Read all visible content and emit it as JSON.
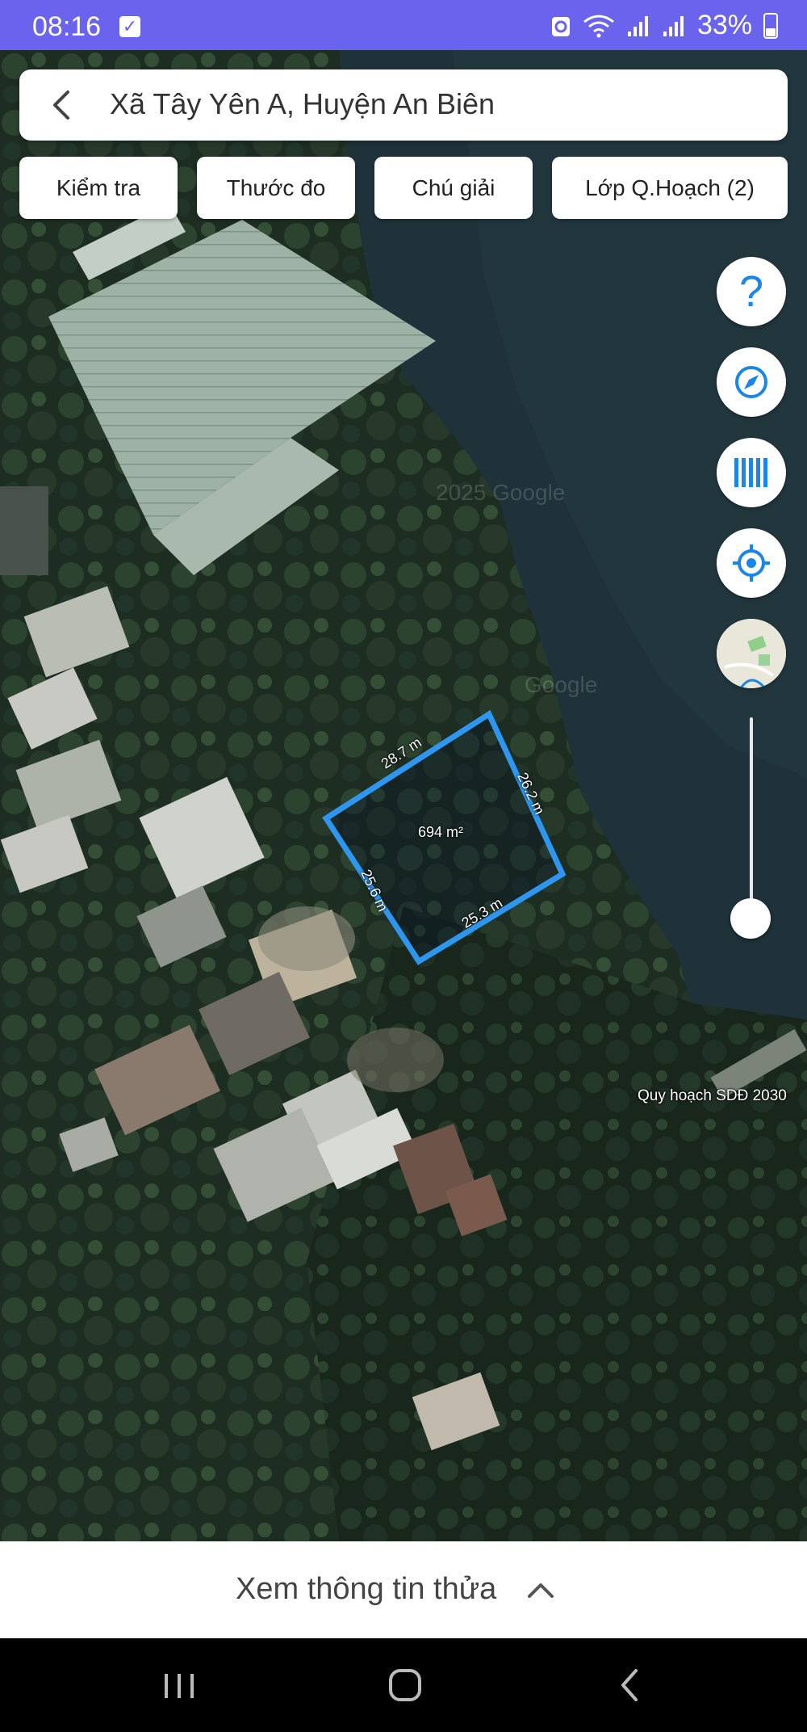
{
  "status_bar": {
    "time": "08:16",
    "battery": "33%",
    "icons": [
      "checkbox-icon",
      "recycle-icon",
      "wifi-icon",
      "signal-icon",
      "signal-icon",
      "battery-icon"
    ]
  },
  "search": {
    "location": "Xã Tây Yên A, Huyện An Biên"
  },
  "toolbar": {
    "check_label": "Kiểm tra",
    "measure_label": "Thước đo",
    "legend_label": "Chú giải",
    "layers_label": "Lớp Q.Hoạch (2)"
  },
  "map_controls": {
    "help_icon": "help-icon",
    "compass_icon": "compass-icon",
    "barcode_icon": "barcode-icon",
    "locate_icon": "locate-icon",
    "basemap_icon": "basemap-thumbnail-icon",
    "zoom_level_fraction": 0.9
  },
  "parcel": {
    "area": "694 m²",
    "edges": [
      "28.7 m",
      "26.2 m",
      "25.3 m",
      "25.6 m"
    ],
    "outline_color": "#2f96ef"
  },
  "map_labels": {
    "layer_name": "Quy hoạch SDĐ 2030",
    "watermark_1": "2025 Google",
    "watermark_2": "Google"
  },
  "bottom_sheet": {
    "label": "Xem thông tin thửa"
  },
  "colors": {
    "status_bar": "#6a63ee",
    "accent": "#1a86e8"
  }
}
